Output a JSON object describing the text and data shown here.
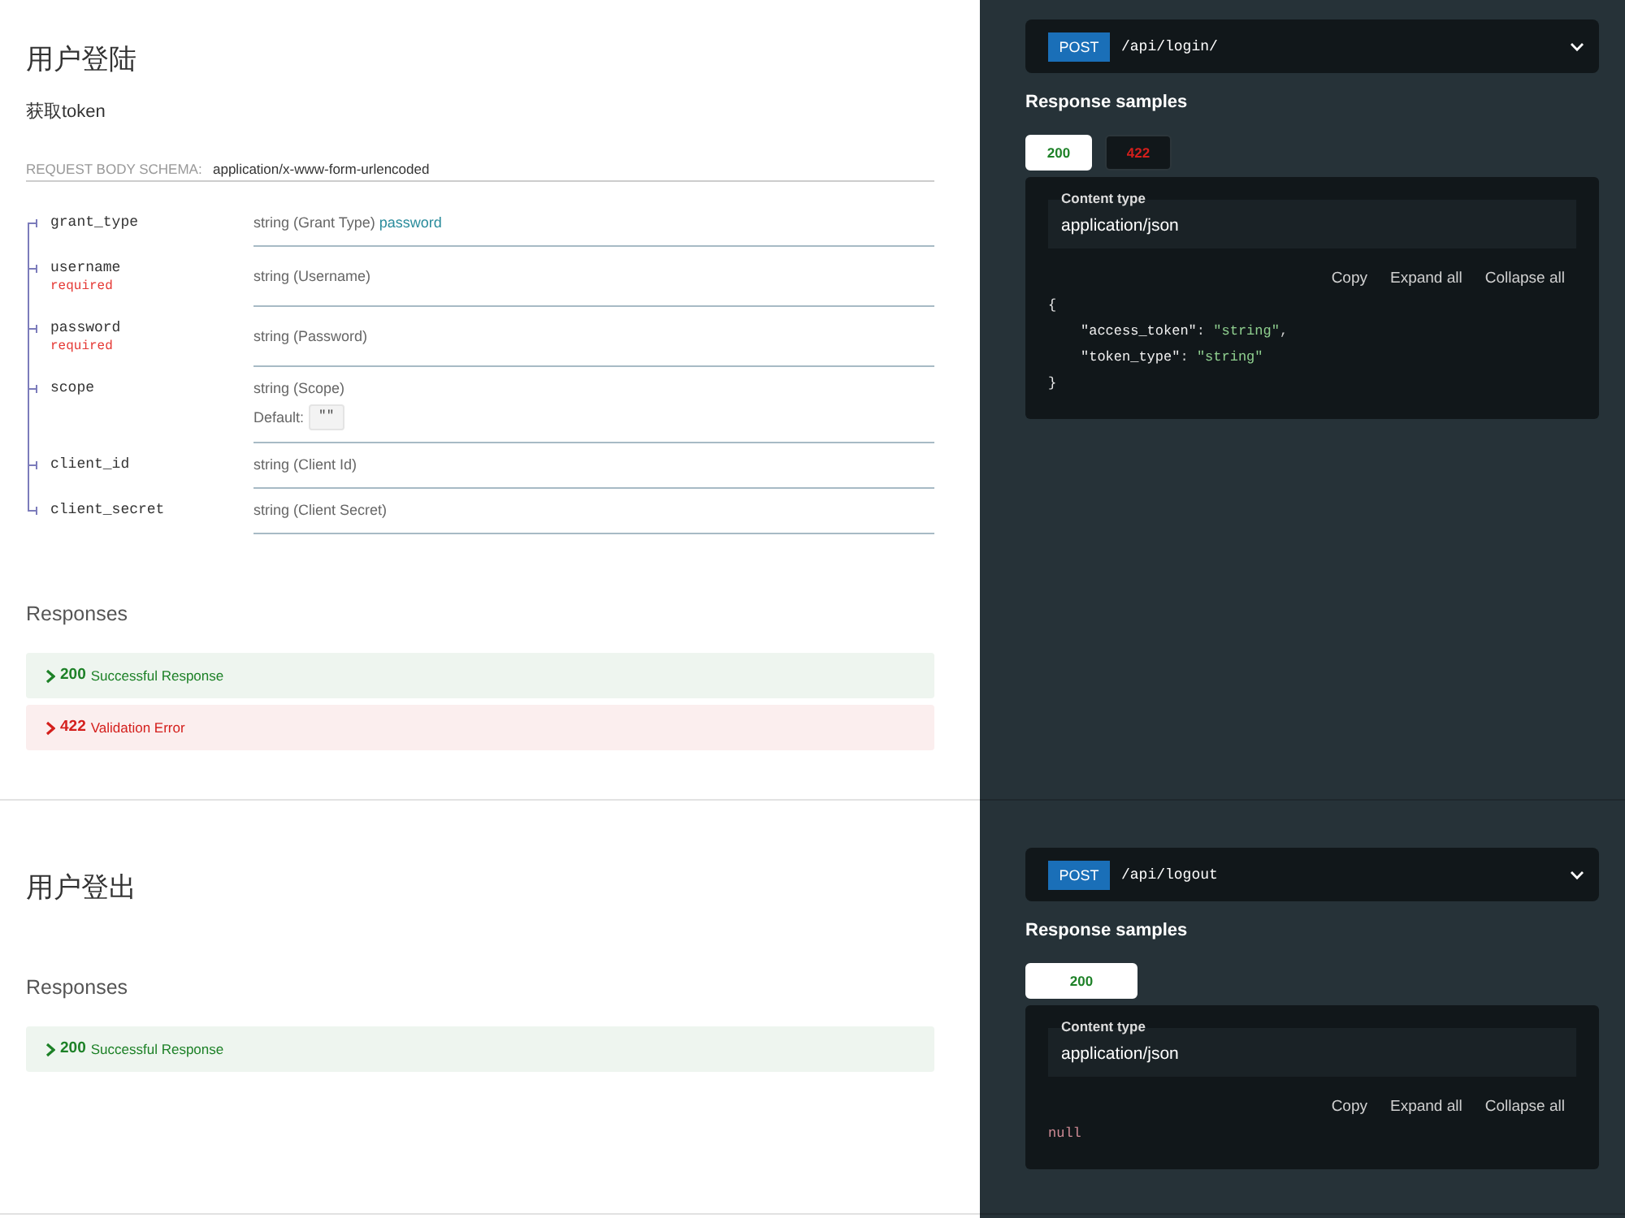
{
  "operations": [
    {
      "title": "用户登陆",
      "description": "获取token",
      "request_body": {
        "label": "REQUEST BODY SCHEMA:",
        "content_type": "application/x-www-form-urlencoded",
        "params": [
          {
            "name": "grant_type",
            "type": "string (Grant Type)",
            "value": "password"
          },
          {
            "name": "username",
            "required": "required",
            "type": "string (Username)"
          },
          {
            "name": "password",
            "required": "required",
            "type": "string (Password)"
          },
          {
            "name": "scope",
            "type": "string (Scope)",
            "default_label": "Default:",
            "default_value": "\"\""
          },
          {
            "name": "client_id",
            "type": "string (Client Id)"
          },
          {
            "name": "client_secret",
            "type": "string (Client Secret)"
          }
        ]
      },
      "responses_heading": "Responses",
      "responses": [
        {
          "code": "200",
          "text": "Successful Response",
          "kind": "success",
          "expanded": false
        },
        {
          "code": "422",
          "text": "Validation Error",
          "kind": "error",
          "expanded": false
        }
      ],
      "endpoint": {
        "method": "POST",
        "path": "/api/login/"
      },
      "samples_heading": "Response samples",
      "sample_tabs": [
        {
          "label": "200",
          "kind": "success",
          "selected": true
        },
        {
          "label": "422",
          "kind": "error",
          "selected": false
        }
      ],
      "sample": {
        "content_type_label": "Content type",
        "content_type": "application/json",
        "actions": [
          "Copy",
          "Expand all",
          "Collapse all"
        ],
        "body": {
          "kind": "object",
          "open": "{",
          "entries": [
            {
              "key": "\"access_token\"",
              "separator": ":",
              "value": "\"string\"",
              "comma": ","
            },
            {
              "key": "\"token_type\"",
              "separator": ":",
              "value": "\"string\""
            }
          ],
          "close": "}"
        }
      }
    },
    {
      "title": "用户登出",
      "responses_heading": "Responses",
      "responses": [
        {
          "code": "200",
          "text": "Successful Response",
          "kind": "success",
          "expanded": false
        }
      ],
      "endpoint": {
        "method": "POST",
        "path": "/api/logout"
      },
      "samples_heading": "Response samples",
      "sample_tabs": [
        {
          "label": "200",
          "kind": "success",
          "selected": true
        }
      ],
      "sample": {
        "content_type_label": "Content type",
        "content_type": "application/json",
        "actions": [
          "Copy",
          "Expand all",
          "Collapse all"
        ],
        "body": {
          "kind": "null",
          "text": "null"
        }
      }
    }
  ]
}
